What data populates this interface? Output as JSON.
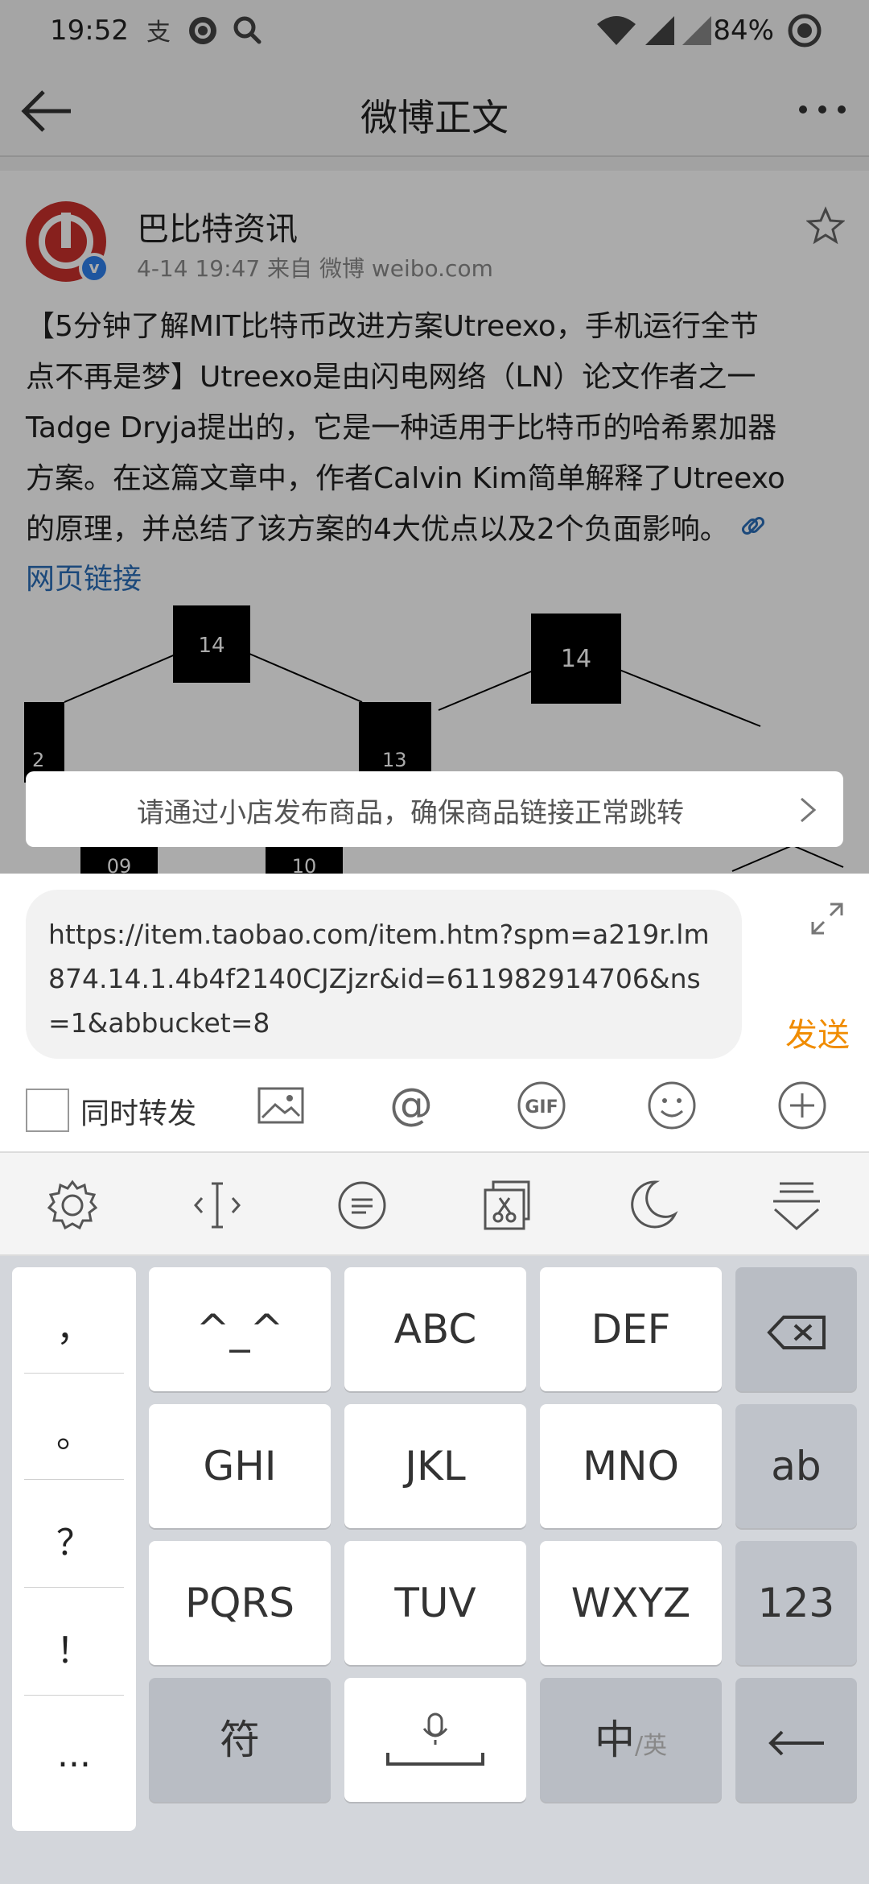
{
  "status_bar": {
    "time": "19:52",
    "battery": "84%"
  },
  "navbar": {
    "title": "微博正文"
  },
  "post": {
    "author": "巴比特资讯",
    "meta": "4-14 19:47  来自 微博 weibo.com",
    "body_lines": [
      "【5分钟了解MIT比特币改进方案Utreexo，手机运行全节",
      "点不再是梦】Utreexo是由闪电网络（LN）论文作者之一",
      "Tadge Dryja提出的，它是一种适用于比特币的哈希累加器",
      "方案。在这篇文章中，作者Calvin Kim简单解释了Utreexo",
      "的原理，并总结了该方案的4大优点以及2个负面影响。"
    ],
    "web_link": "网页链接",
    "diagram_labels": [
      "14",
      "2",
      "13",
      "14",
      "09",
      "10"
    ]
  },
  "notice": {
    "text": "请通过小店发布商品，确保商品链接正常跳转"
  },
  "compose": {
    "url": "https://item.taobao.com/item.htm?spm=a219r.lm874.14.1.4b4f2140CJZjzr&id=611982914706&ns=1&abbucket=8",
    "send_label": "发送",
    "repost_label": "同时转发",
    "repost_checked": false,
    "send_color": "#f08c00"
  },
  "keyboard": {
    "toolbar_icons": [
      "gear-icon",
      "cursor-icon",
      "chat-icon",
      "clipboard-icon",
      "moon-icon",
      "collapse-icon"
    ],
    "punctuation": [
      "，",
      "。",
      "？",
      "！",
      "..."
    ],
    "keys": {
      "emoticon": "^_^",
      "abc": "ABC",
      "def": "DEF",
      "ghi": "GHI",
      "jkl": "JKL",
      "mno": "MNO",
      "ab": "ab",
      "pqrs": "PQRS",
      "tuv": "TUV",
      "wxyz": "WXYZ",
      "num": "123",
      "symbol": "符",
      "lang_main": "中",
      "lang_sub": "/英"
    }
  }
}
